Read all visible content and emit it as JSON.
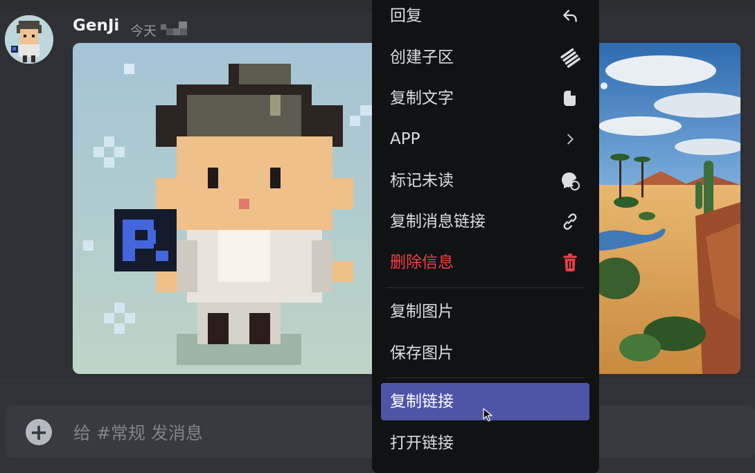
{
  "message": {
    "username": "GenJi",
    "timestamp": "今天",
    "avatar_icon": "pixel-avatar",
    "images": [
      "pixel-art-character",
      "desert-oasis-painting"
    ]
  },
  "composer": {
    "placeholder": "给 #常规 发消息",
    "add_icon": "plus-circle-icon"
  },
  "context_menu": {
    "items": [
      {
        "label": "回复",
        "icon": "reply-icon"
      },
      {
        "label": "创建子区",
        "icon": "thread-icon"
      },
      {
        "label": "复制文字",
        "icon": "copy-text-icon"
      },
      {
        "label": "APP",
        "icon": "chevron-right-icon"
      },
      {
        "label": "标记未读",
        "icon": "mark-unread-icon"
      },
      {
        "label": "复制消息链接",
        "icon": "link-icon"
      },
      {
        "label": "删除信息",
        "icon": "trash-icon",
        "danger": true
      },
      {
        "label": "复制图片"
      },
      {
        "label": "保存图片"
      },
      {
        "label": "复制链接",
        "highlighted": true
      },
      {
        "label": "打开链接"
      }
    ]
  },
  "colors": {
    "background": "#313338",
    "menu_background": "#111214",
    "highlight": "#4e55a6",
    "danger": "#f23f43"
  }
}
